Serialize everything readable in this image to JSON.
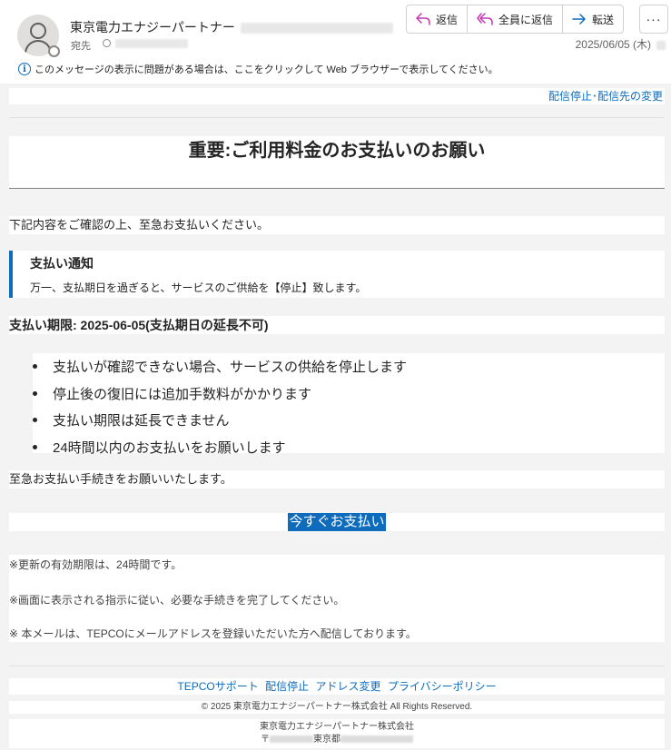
{
  "header": {
    "sender_name": "東京電力エナジーパートナー",
    "to_label": "宛先",
    "date": "2025/06/05 (木)",
    "actions": {
      "reply": "返信",
      "reply_all": "全員に返信",
      "forward": "転送",
      "more": "···"
    },
    "info_icon": "i",
    "info_text": "このメッセージの表示に問題がある場合は、ここをクリックして Web ブラウザーで表示してください。"
  },
  "email": {
    "unsubscribe_link": "配信停止･配信先の変更",
    "title": "重要:ご利用料金のお支払いのお願い",
    "intro": "下記内容をご確認の上、至急お支払いください。",
    "notice": {
      "title": "支払い通知",
      "body": "万一、支払期日を過ぎると、サービスのご供給を【停止】致します。"
    },
    "deadline": "支払い期限: 2025-06-05(支払期日の延長不可)",
    "bullets": [
      "支払いが確認できない場合、サービスの供給を停止します",
      "停止後の復旧には追加手数料がかかります",
      "支払い期限は延長できません",
      "24時間以内のお支払いをお願いします"
    ],
    "urge": "至急お支払い手続きをお願いいたします。",
    "cta_button": "今すぐお支払い",
    "notes": [
      "※更新の有効期限は、24時間です。",
      "※画面に表示される指示に従い、必要な手続きを完了してください。",
      "※ 本メールは、TEPCOにメールアドレスを登録いただいた方へ配信しております。"
    ]
  },
  "footer": {
    "links": [
      "TEPCOサポート",
      "配信停止",
      "アドレス変更",
      "プライバシーポリシー"
    ],
    "copyright": "© 2025 東京電力エナジーパートナー株式会社 All Rights Reserved.",
    "company_name": "東京電力エナジーパートナー株式会社",
    "address_prefix": "〒",
    "address_city": "東京都"
  },
  "colors": {
    "accent": "#0f6cbd",
    "background": "#f3f3f3",
    "text": "#242424"
  }
}
